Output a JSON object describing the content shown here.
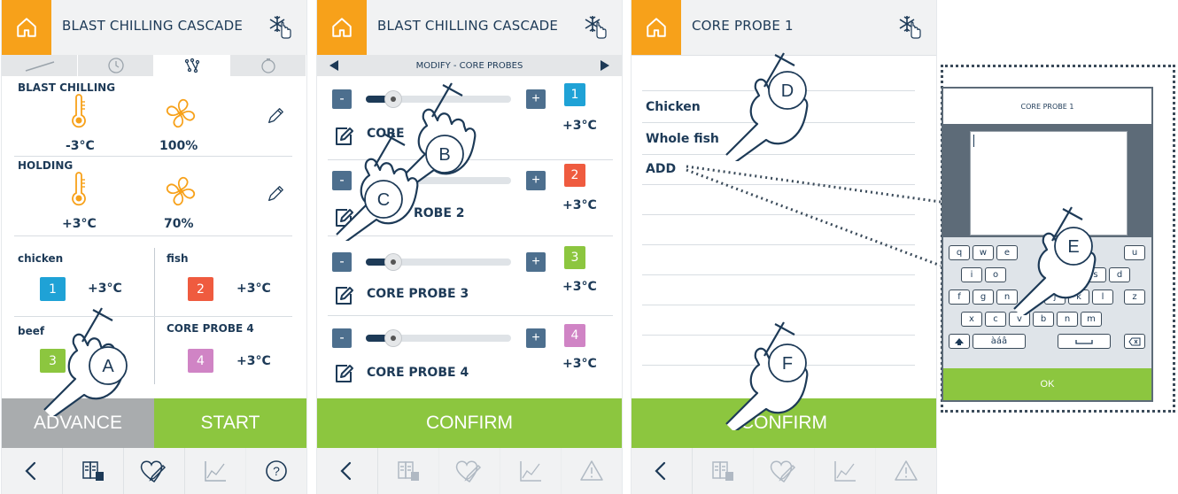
{
  "colors": {
    "orange": "#f7a11a",
    "green": "#8cc63f",
    "navy": "#1d3a57",
    "gray": "#a9acae",
    "blue": "#1fa2d6",
    "red": "#ef5b3f",
    "pink": "#d084c5"
  },
  "screen1": {
    "title": "BLAST CHILLING CASCADE",
    "blast": {
      "label": "BLAST CHILLING",
      "temp": "-3°C",
      "fan": "100%"
    },
    "holding": {
      "label": "HOLDING",
      "temp": "+3°C",
      "fan": "70%"
    },
    "probes": [
      {
        "name": "chicken",
        "num": "1",
        "temp": "+3°C"
      },
      {
        "name": "fish",
        "num": "2",
        "temp": "+3°C"
      },
      {
        "name": "beef",
        "num": "3",
        "temp": ""
      },
      {
        "name": "CORE PROBE 4",
        "num": "4",
        "temp": "+3°C"
      }
    ],
    "advance": "ADVANCE",
    "start": "START",
    "hand": "A"
  },
  "screen2": {
    "title": "BLAST CHILLING CASCADE",
    "modify": "MODIFY - CORE PROBES",
    "probes": [
      {
        "name": "CORE",
        "num": "1",
        "temp": "+3°C"
      },
      {
        "name": "ROBE 2",
        "num": "2",
        "temp": "+3°C"
      },
      {
        "name": "CORE PROBE 3",
        "num": "3",
        "temp": "+3°C"
      },
      {
        "name": "CORE PROBE 4",
        "num": "4",
        "temp": "+3°C"
      }
    ],
    "minus": "-",
    "plus": "+",
    "confirm": "CONFIRM",
    "handB": "B",
    "handC": "C"
  },
  "screen3": {
    "title": "CORE PROBE 1",
    "items": [
      "Chicken",
      "Whole fish",
      "ADD"
    ],
    "confirm": "CONFIRM",
    "handD": "D",
    "handF": "F"
  },
  "keyboard": {
    "title": "CORE PROBE 1",
    "row1": [
      "q",
      "w",
      "e",
      "",
      "",
      "",
      "u"
    ],
    "row2": [
      "i",
      "o",
      "",
      "s",
      "d"
    ],
    "row3": [
      "f",
      "g",
      "n",
      "j",
      "k",
      "l",
      "z"
    ],
    "row4": [
      "x",
      "c",
      "v",
      "b",
      "n",
      "m"
    ],
    "accent": "àáâ",
    "ok": "OK",
    "hand": "E"
  },
  "icons": {
    "home": "home-icon",
    "snowflake": "snowflake-hand-icon",
    "back": "back-icon",
    "recipes": "recipe-book-icon",
    "favorites": "favorites-icon",
    "graph": "graph-icon",
    "help": "help-icon",
    "alarm": "alarm-icon",
    "edit": "pencil-icon",
    "thermometer": "thermometer-icon",
    "fan": "fan-icon"
  }
}
